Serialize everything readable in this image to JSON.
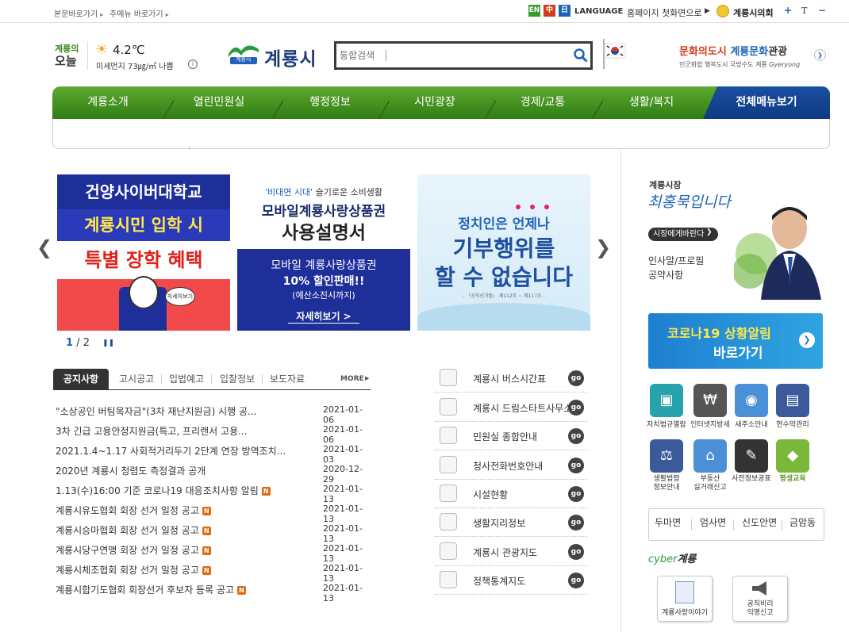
{
  "topbar": {
    "skip1": "본문바로가기",
    "skip2": "주메뉴 바로가기",
    "lang_en": "EN",
    "lang_cn": "中",
    "lang_jp": "日",
    "language": "LANGUAGE",
    "home_first": "홈페이지 첫화면으로",
    "council": "계룡시의회",
    "zoom_in": "+",
    "font_t": "T",
    "zoom_out": "−"
  },
  "weather": {
    "l1": "계룡의",
    "l2": "오늘",
    "temp": "4.2℃",
    "dust": "미세먼지 73㎍/㎥ 나쁨",
    "info": "i"
  },
  "logo": {
    "text": "계룡시",
    "emblem": "계룡시"
  },
  "search": {
    "placeholder": "통합검색"
  },
  "slogan": {
    "main1": "문화의도시",
    "main2": "계룡문화",
    "main3": "관광",
    "sub": "민군화합 행복도시 국방수도 계룡",
    "sub2": "Gyeryong"
  },
  "gnb": {
    "items": [
      "계룡소개",
      "열린민원실",
      "행정정보",
      "시민광장",
      "경제/교통",
      "생활/복지"
    ],
    "all": "전체메뉴보기"
  },
  "banners": {
    "b1": {
      "line1": "건양사이버대학교",
      "line2": "계룡시민 입학 시",
      "line3": "특별 장학 혜택",
      "more": "자세히보기"
    },
    "b2": {
      "tag1": "'비대면 시대'",
      "tag2": "슬기로운 소비생활",
      "line1": "모바일계룡사랑상품권",
      "line2": "사용설명서",
      "box1": "모바일 계룡사랑상품권",
      "box2": "10% 할인판매!!",
      "box3": "(예산소진시까지)",
      "more": "자세히보기 >"
    },
    "b3": {
      "line1": "정치인은 언제나",
      "line2": "기부행위를",
      "line3": "할 수 없습니다",
      "foot": "- 「공직선거법」 제112조 ~ 제117조 -"
    },
    "pager_cur": "1",
    "pager_sep": "/",
    "pager_total": "2",
    "prev": "❮",
    "next": "❯",
    "pause": "❚❚"
  },
  "notice": {
    "tabs": [
      "공지사항",
      "고시공고",
      "입법예고",
      "입찰정보",
      "보도자료"
    ],
    "more": "MORE",
    "new": "N",
    "rows": [
      {
        "title": "\"소상공인 버팀목자금\"(3차 재난지원금) 시행 공...",
        "date": "2021-01-06"
      },
      {
        "title": "3차 긴급 고용안정지원금(특고, 프리랜서 고용...",
        "date": "2021-01-06"
      },
      {
        "title": "2021.1.4~1.17 사회적거리두기 2단계 연장 방역조치...",
        "date": "2021-01-03"
      },
      {
        "title": "2020년 계룡시 청렴도 측정결과 공개",
        "date": "2020-12-29"
      },
      {
        "title": "1.13(수)16:00 기준 코로나19 대응조치사항 알림",
        "date": "2021-01-13"
      },
      {
        "title": "계룡시유도협회 회장 선거 일정 공고",
        "date": "2021-01-13"
      },
      {
        "title": "계룡시승마협회 회장 선거 일정 공고",
        "date": "2021-01-13"
      },
      {
        "title": "계룡시당구연맹 회장 선거 일정 공고",
        "date": "2021-01-13"
      },
      {
        "title": "계룡시체조협회 회장 선거 일정 공고",
        "date": "2021-01-13"
      },
      {
        "title": "계룡시합기도협회 회장선거 후보자 등록 공고",
        "date": "2021-01-13"
      }
    ]
  },
  "quick": {
    "go": "go",
    "items": [
      "계룡시 버스시간표",
      "계룡시 드림스타트사무소",
      "민원실 종합안내",
      "청사전화번호안내",
      "시설현황",
      "생활지리정보",
      "계룡시 관광지도",
      "정책통계지도"
    ]
  },
  "mayor": {
    "title": "계룡시장",
    "name": "최홍묵입니다",
    "button": "시장에게바란다",
    "link1": "인사말/프로필",
    "link2": "공약사항"
  },
  "covid": {
    "line1": "코로나19 상황알림",
    "line2": "바로가기",
    "arrow": "❯"
  },
  "icons": [
    {
      "l1": "자치법규열람",
      "l2": ""
    },
    {
      "l1": "인터넷지방세",
      "l2": ""
    },
    {
      "l1": "새주소안내",
      "l2": ""
    },
    {
      "l1": "현수막관리",
      "l2": ""
    },
    {
      "l1": "생활법령",
      "l2": "정보안내"
    },
    {
      "l1": "부동산",
      "l2": "실거래신고"
    },
    {
      "l1": "사전정보공표",
      "l2": ""
    },
    {
      "l1": "평생교육",
      "l2": ""
    }
  ],
  "towns": [
    "두마면",
    "엄사면",
    "신도안면",
    "금암동"
  ],
  "cyber": {
    "title1": "cyber",
    "title2": "계룡",
    "c1": "계룡사랑이야기",
    "c2a": "공직비리",
    "c2b": "익명신고"
  }
}
